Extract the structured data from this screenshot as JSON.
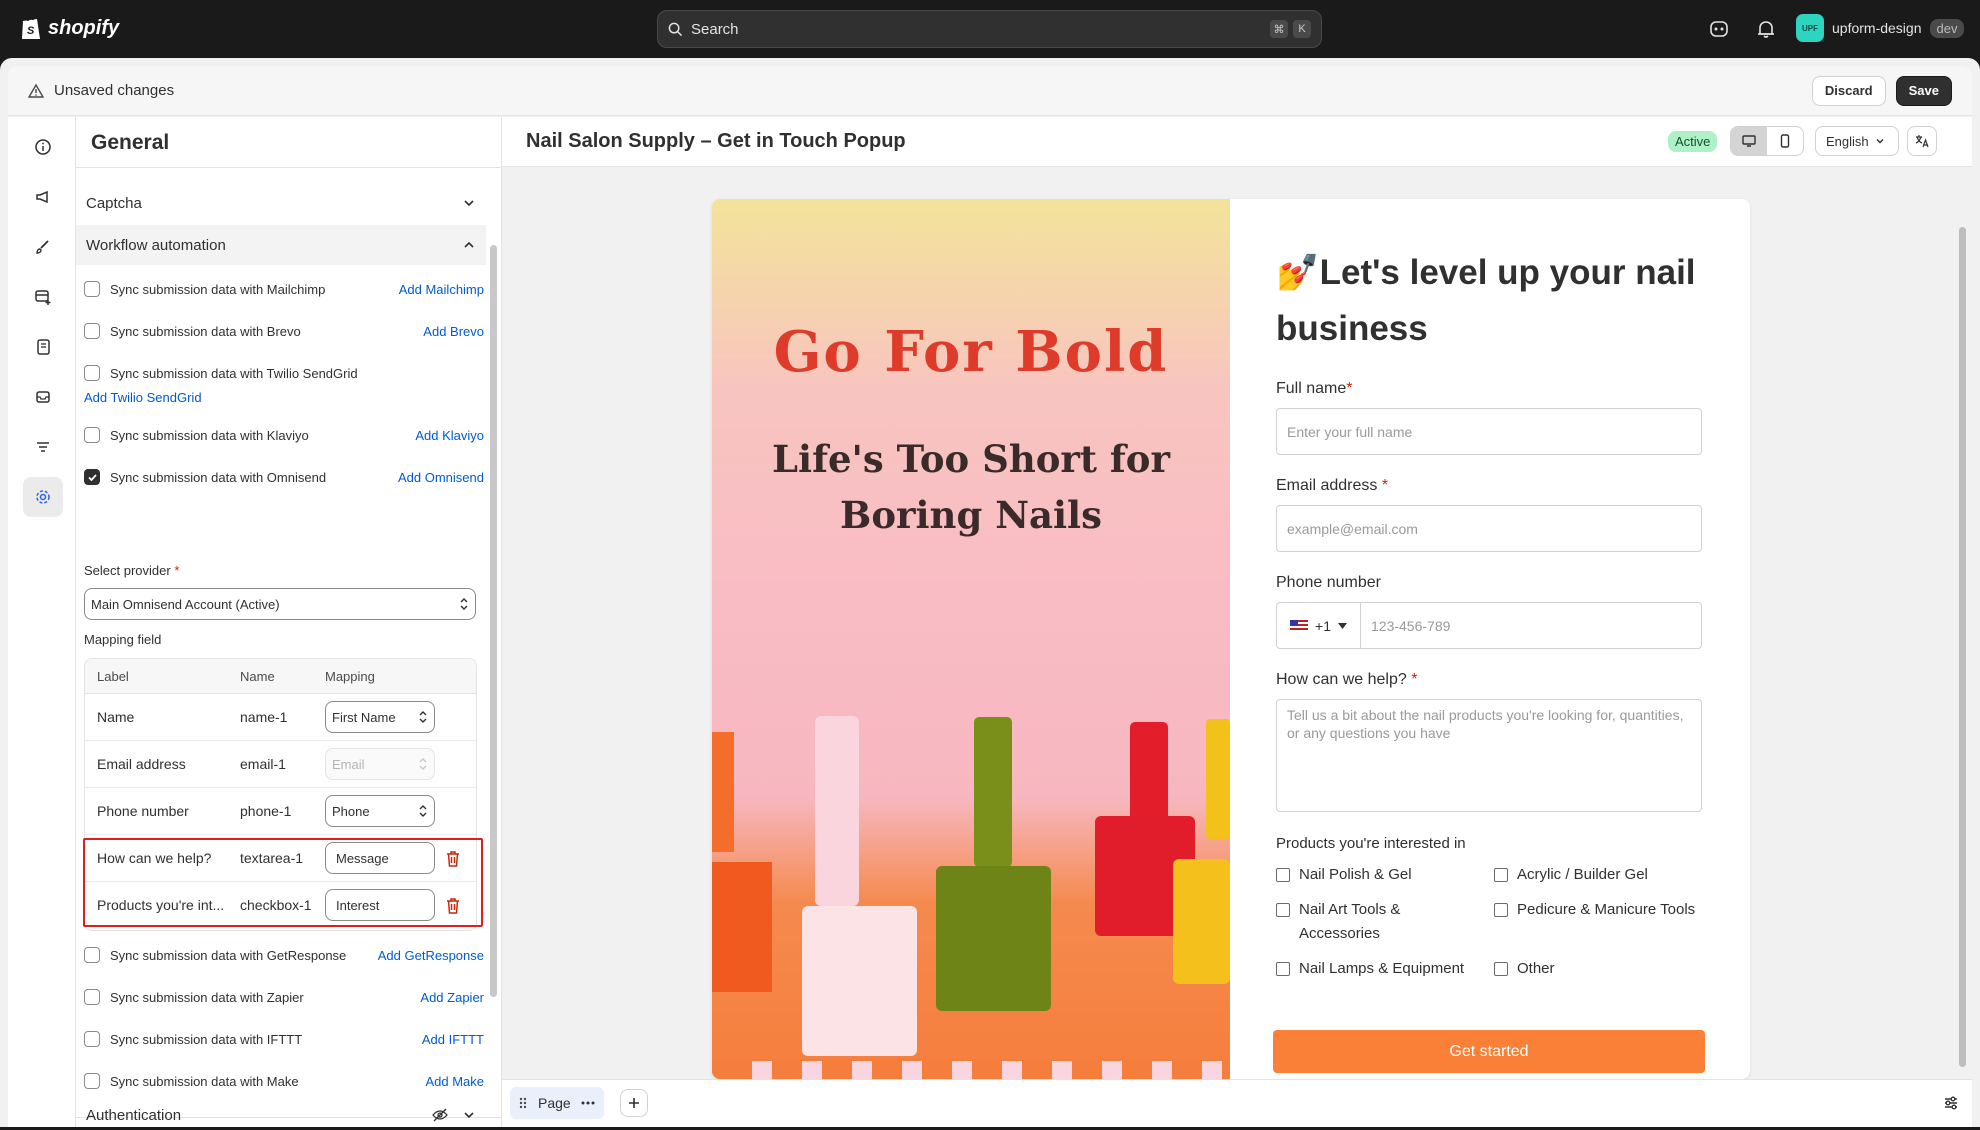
{
  "app": {
    "brand": "shopify",
    "search_placeholder": "Search",
    "kbd1": "⌘",
    "kbd2": "K",
    "user_initials": "UPF",
    "store_name": "upform-design",
    "store_tag": "dev"
  },
  "save_bar": {
    "message": "Unsaved changes",
    "discard": "Discard",
    "save": "Save"
  },
  "sidebar": {
    "title": "General",
    "captcha": "Captcha",
    "workflow": "Workflow automation",
    "authentication": "Authentication",
    "integrations_top": [
      {
        "label": "Sync submission data with Mailchimp",
        "link": "Add Mailchimp",
        "checked": false
      },
      {
        "label": "Sync submission data with Brevo",
        "link": "Add Brevo",
        "checked": false
      },
      {
        "label": "Sync submission data with Twilio SendGrid",
        "link": "Add Twilio SendGrid",
        "checked": false
      },
      {
        "label": "Sync submission data with Klaviyo",
        "link": "Add Klaviyo",
        "checked": false
      },
      {
        "label": "Sync submission data with Omnisend",
        "link": "Add Omnisend",
        "checked": true
      }
    ],
    "select_provider_label": "Select provider",
    "provider_value": "Main Omnisend Account (Active)",
    "mapping_label": "Mapping field",
    "mapping_headers": [
      "Label",
      "Name",
      "Mapping"
    ],
    "mapping_rows": [
      {
        "label": "Name",
        "name": "name-1",
        "mapping": "First Name"
      },
      {
        "label": "Email address",
        "name": "email-1",
        "mapping": "Email"
      },
      {
        "label": "Phone number",
        "name": "phone-1",
        "mapping": "Phone"
      },
      {
        "label": "How can we help?",
        "name": "textarea-1",
        "mapping": "Message"
      },
      {
        "label": "Products you're int...",
        "name": "checkbox-1",
        "mapping": "Interest"
      }
    ],
    "integrations_bottom": [
      {
        "label": "Sync submission data with GetResponse",
        "link": "Add GetResponse"
      },
      {
        "label": "Sync submission data with Zapier",
        "link": "Add Zapier"
      },
      {
        "label": "Sync submission data with IFTTT",
        "link": "Add IFTTT"
      },
      {
        "label": "Sync submission data with Make",
        "link": "Add Make"
      }
    ]
  },
  "editor": {
    "title": "Nail Salon Supply – Get in Touch Popup",
    "status": "Active",
    "language": "English",
    "page_label": "Page"
  },
  "form": {
    "hero_title": "Go For Bold",
    "hero_subtitle": "Life's Too Short for Boring Nails",
    "emoji": "💅",
    "heading": "Let's level up your nail business",
    "full_name_label": "Full name",
    "full_name_placeholder": "Enter your full name",
    "email_label": "Email address",
    "email_placeholder": "example@email.com",
    "phone_label": "Phone number",
    "phone_code": "+1",
    "phone_placeholder": "123-456-789",
    "help_label": "How can we help?",
    "help_placeholder": "Tell us a bit about the nail products you're looking for, quantities, or any questions you have",
    "products_label": "Products you're interested in",
    "products": [
      "Nail Polish & Gel",
      "Acrylic / Builder Gel",
      "Nail Art Tools & Accessories",
      "Pedicure & Manicure Tools",
      "Nail Lamps & Equipment",
      "Other"
    ],
    "submit": "Get started"
  },
  "colors": {
    "accent": "#fb8037",
    "hero_text": "#de3b2a",
    "link": "#005bd3",
    "highlight": "#e01e1e"
  }
}
